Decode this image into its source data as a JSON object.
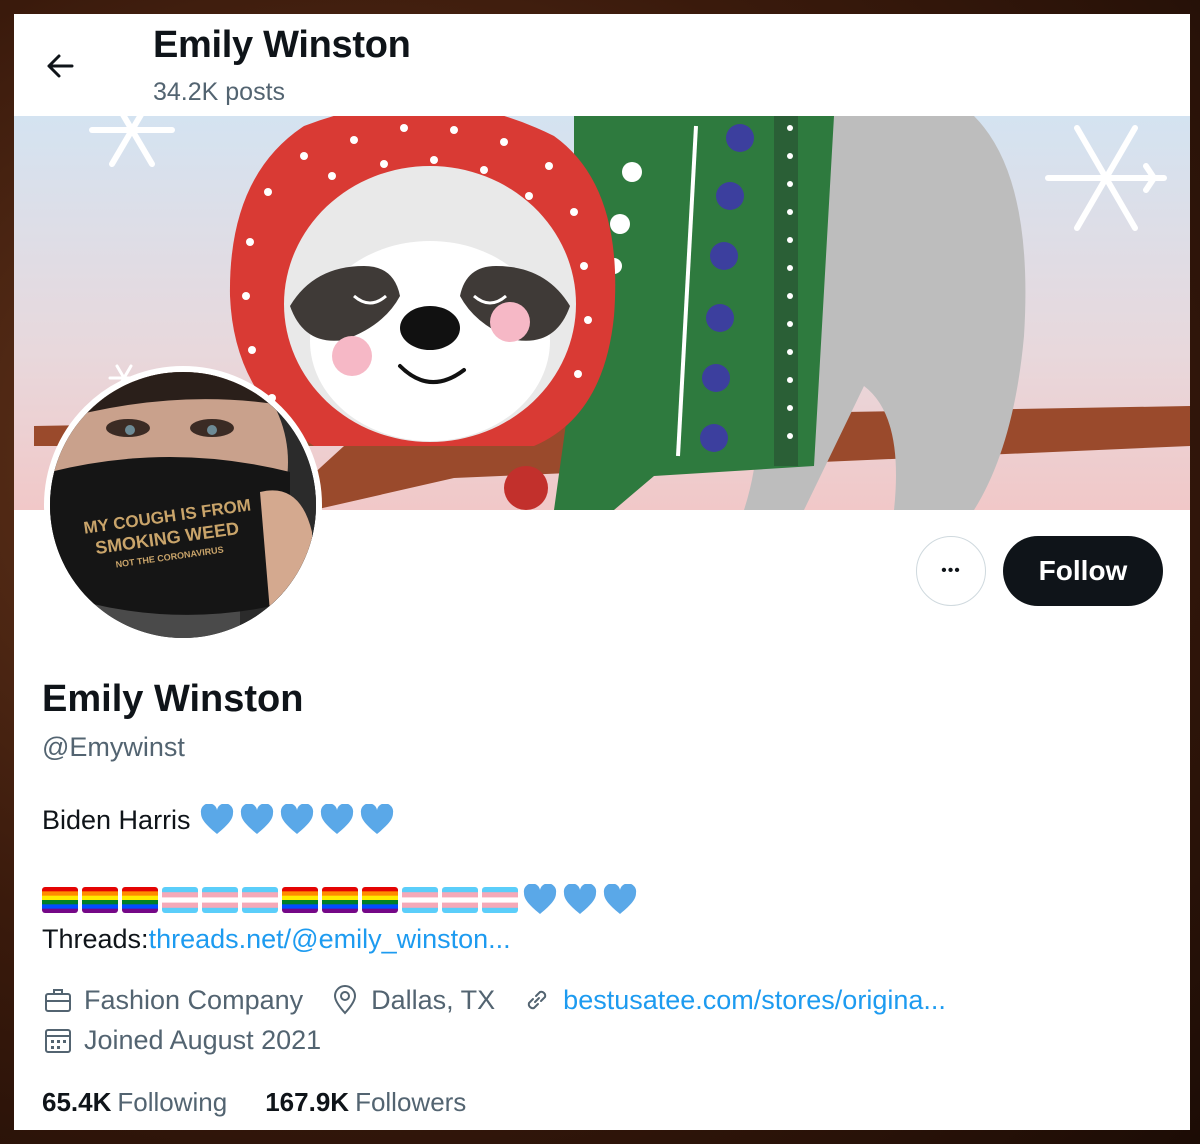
{
  "header": {
    "title": "Emily Winston",
    "posts": "34.2K posts"
  },
  "avatar": {
    "mask_text_line1": "MY COUGH IS FROM",
    "mask_text_line2": "SMOKING WEED",
    "mask_text_line3": "NOT THE CORONAVIRUS"
  },
  "actions": {
    "more_label": "•••",
    "follow_label": "Follow"
  },
  "profile": {
    "display_name": "Emily Winston",
    "handle": "@Emywinst",
    "bio_text": "Biden Harris",
    "bio_hearts": 5,
    "flags": [
      "rainbow",
      "rainbow",
      "rainbow",
      "trans",
      "trans",
      "trans",
      "rainbow",
      "rainbow",
      "rainbow",
      "trans",
      "trans",
      "trans"
    ],
    "flag_hearts": 3,
    "threads_label": "Threads:",
    "threads_link": "threads.net/@emily_winston..."
  },
  "meta": {
    "category_icon": "briefcase-icon",
    "category": "Fashion Company",
    "location_icon": "location-pin-icon",
    "location": "Dallas, TX",
    "link_icon": "link-icon",
    "website": "bestusatee.com/stores/origina...",
    "joined_icon": "calendar-icon",
    "joined": "Joined August 2021"
  },
  "stats": {
    "following_count": "65.4K",
    "following_label": "Following",
    "followers_count": "167.9K",
    "followers_label": "Followers"
  },
  "colors": {
    "accent": "#1d9bf0",
    "text_primary": "#0f1419",
    "text_secondary": "#536471",
    "heart": "#5aa8e8"
  }
}
